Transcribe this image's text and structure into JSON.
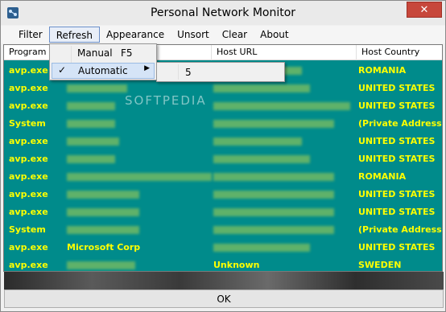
{
  "window": {
    "title": "Personal Network Monitor",
    "close_label": "✕"
  },
  "menubar": {
    "items": [
      {
        "label": "Filter"
      },
      {
        "label": "Refresh"
      },
      {
        "label": "Appearance"
      },
      {
        "label": "Unsort"
      },
      {
        "label": "Clear"
      },
      {
        "label": "About"
      }
    ]
  },
  "refresh_menu": {
    "items": [
      {
        "label": "Manual",
        "shortcut": "F5"
      },
      {
        "label": "Automatic",
        "checked": "✓",
        "arrow": "▶"
      }
    ],
    "submenu": {
      "items": [
        {
          "label": "5"
        }
      ]
    }
  },
  "watermark": "SOFTPEDIA",
  "table": {
    "columns": [
      "Program",
      "Host URL",
      "Host Country"
    ],
    "rows": [
      {
        "program": "avp.exe",
        "owner": "",
        "url": "",
        "country": "ROMANIA"
      },
      {
        "program": "avp.exe",
        "owner": "",
        "url": "",
        "country": "UNITED STATES"
      },
      {
        "program": "avp.exe",
        "owner": "",
        "url": "",
        "country": "UNITED STATES"
      },
      {
        "program": "System",
        "owner": "",
        "url": "",
        "country": "(Private Address)"
      },
      {
        "program": "avp.exe",
        "owner": "",
        "url": "",
        "country": "UNITED STATES"
      },
      {
        "program": "avp.exe",
        "owner": "",
        "url": "",
        "country": "UNITED STATES"
      },
      {
        "program": "avp.exe",
        "owner": "",
        "url": "",
        "country": "ROMANIA"
      },
      {
        "program": "avp.exe",
        "owner": "",
        "url": "",
        "country": "UNITED STATES"
      },
      {
        "program": "avp.exe",
        "owner": "",
        "url": "",
        "country": "UNITED STATES"
      },
      {
        "program": "System",
        "owner": "",
        "url": "",
        "country": "(Private Address)"
      },
      {
        "program": "avp.exe",
        "owner": "Microsoft Corp",
        "url": "",
        "country": "UNITED STATES"
      },
      {
        "program": "avp.exe",
        "owner": "",
        "url": "Unknown",
        "country": "SWEDEN"
      }
    ]
  },
  "ok_button": "OK",
  "colors": {
    "list_bg": "#008b8b",
    "row_text": "#ffff00"
  }
}
